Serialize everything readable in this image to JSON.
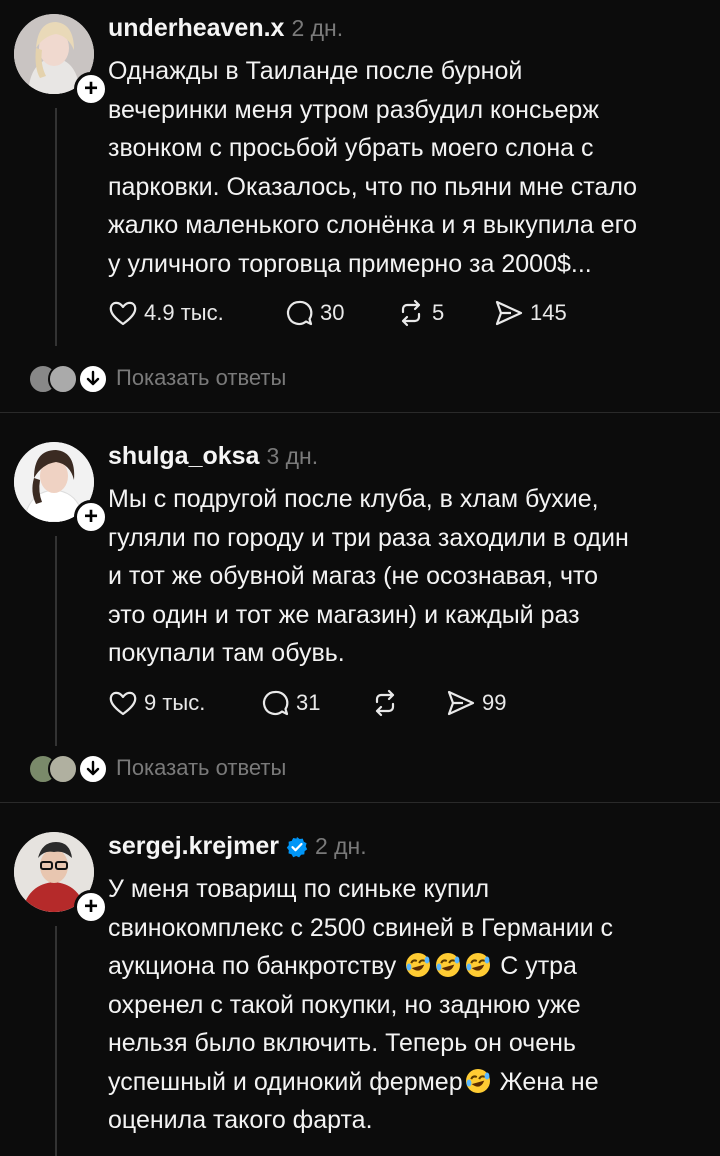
{
  "posts": [
    {
      "username": "underheaven.x",
      "time": "2 дн.",
      "lines": [
        "Однажды в Таиланде после бурной",
        "вечеринки меня утром разбудил консьерж",
        "звонком с просьбой убрать моего слона с",
        "парковки. Оказалось, что по пьяни мне стало",
        "жалко маленького слонёнка и я выкупила его",
        "у уличного торговца примерно за 2000$..."
      ],
      "likes": "4.9 тыс.",
      "comments": "30",
      "reposts": "5",
      "shares": "145",
      "show_replies": "Показать ответы"
    },
    {
      "username": "shulga_oksa",
      "time": "3 дн.",
      "lines": [
        "Мы с подругой после клуба, в хлам бухие,",
        "гуляли по городу и три раза заходили в один",
        "и тот же обувной магаз (не осознавая, что",
        "это один и тот же магазин) и каждый раз",
        "покупали там обувь."
      ],
      "likes": "9 тыс.",
      "comments": "31",
      "reposts": "",
      "shares": "99",
      "show_replies": "Показать ответы"
    },
    {
      "username": "sergej.krejmer",
      "time": "2 дн.",
      "verified": true,
      "lines": [
        "У меня товарищ по синьке купил",
        "свинокомплекс с 2500 свиней в Германии с",
        "аукциона по банкротству",
        "С утра",
        "охренел с такой покупки, но заднюю уже",
        "нельзя было включить. Теперь он очень",
        "успешный и одинокий фермер",
        "Жена не",
        "оценила такого фарта."
      ]
    }
  ],
  "icons": {
    "like": "heart-icon",
    "comment": "comment-bubble-icon",
    "repost": "repost-arrows-icon",
    "share": "send-icon",
    "emoji": "rofl-emoji-icon",
    "verified": "verified-badge-icon",
    "follow": "plus-icon",
    "expand": "chevron-down-icon"
  },
  "colors": {
    "background": "#0c0c0c",
    "text": "#f3f3f3",
    "muted": "#7a7a7a",
    "verified": "#0095f6",
    "emoji": "#ffcc33"
  }
}
